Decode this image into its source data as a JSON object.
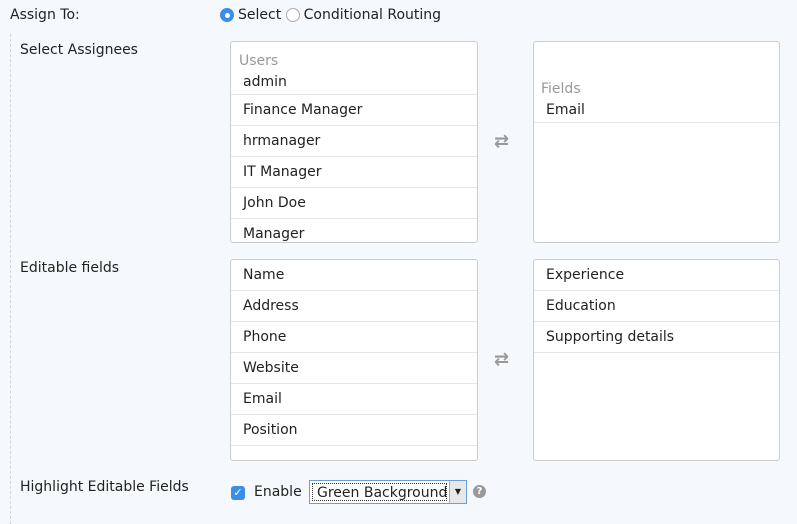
{
  "assign": {
    "label": "Assign To:",
    "options": [
      "Select",
      "Conditional Routing"
    ],
    "selected": "Select"
  },
  "assignees": {
    "label": "Select Assignees",
    "left_header": "Users",
    "left_items": [
      "admin",
      "Finance Manager",
      "hrmanager",
      "IT Manager",
      "John Doe",
      "Manager"
    ],
    "right_header": "Fields",
    "right_items": [
      "Email"
    ],
    "transfer_icon": "swap-arrows-icon"
  },
  "editable": {
    "label": "Editable fields",
    "left_items": [
      "Name",
      "Address",
      "Phone",
      "Website",
      "Email",
      "Position"
    ],
    "right_items": [
      "Experience",
      "Education",
      "Supporting details"
    ]
  },
  "highlight": {
    "label": "Highlight Editable Fields",
    "checkbox_label": "Enable",
    "checked": true,
    "select_value": "Green Background",
    "help_icon": "help-icon"
  },
  "colors": {
    "accent": "#3b8de6",
    "background": "#f5f9fd"
  }
}
